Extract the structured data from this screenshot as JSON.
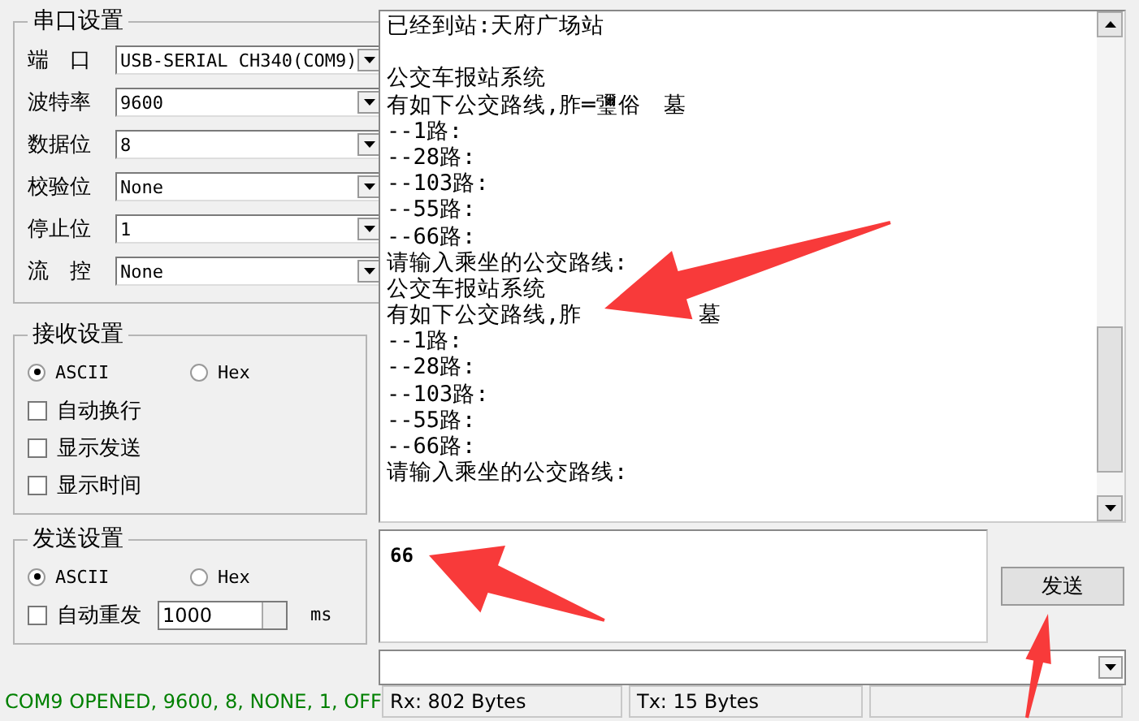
{
  "serial_settings": {
    "title": "串口设置",
    "fields": [
      {
        "label": "端　口",
        "value": "USB-SERIAL CH340(COM9)"
      },
      {
        "label": "波特率",
        "value": "9600"
      },
      {
        "label": "数据位",
        "value": "8"
      },
      {
        "label": "校验位",
        "value": "None"
      },
      {
        "label": "停止位",
        "value": "1"
      },
      {
        "label": "流　控",
        "value": "None"
      }
    ]
  },
  "receive_settings": {
    "title": "接收设置",
    "modes": [
      {
        "label": "ASCII",
        "selected": true
      },
      {
        "label": "Hex",
        "selected": false
      }
    ],
    "options": [
      {
        "label": "自动换行",
        "checked": false
      },
      {
        "label": "显示发送",
        "checked": false
      },
      {
        "label": "显示时间",
        "checked": false
      }
    ]
  },
  "send_settings": {
    "title": "发送设置",
    "modes": [
      {
        "label": "ASCII",
        "selected": true
      },
      {
        "label": "Hex",
        "selected": false
      }
    ],
    "auto_resend": {
      "label": "自动重发",
      "checked": false,
      "interval": "1000",
      "unit": "ms"
    }
  },
  "receive_area": {
    "lines": [
      {
        "kind": "text",
        "text": "已经到站:天府广场站"
      },
      {
        "kind": "blank"
      },
      {
        "kind": "text",
        "text": "公交车报站系统"
      },
      {
        "kind": "text",
        "text": "有如下公交路线,胙═瓕俗　墓"
      },
      {
        "kind": "text",
        "text": "--1路:"
      },
      {
        "kind": "text",
        "text": "--28路:"
      },
      {
        "kind": "text",
        "text": "--103路:"
      },
      {
        "kind": "text",
        "text": "--55路:"
      },
      {
        "kind": "text",
        "text": "--66路:"
      },
      {
        "kind": "text",
        "text": "请输入乘坐的公交路线:"
      },
      {
        "kind": "text",
        "text": "公交车报站系统"
      },
      {
        "kind": "text",
        "text": "有如下公交路线,胙",
        "tail": "墓"
      },
      {
        "kind": "text",
        "text": "--1路:"
      },
      {
        "kind": "text",
        "text": "--28路:"
      },
      {
        "kind": "text",
        "text": "--103路:"
      },
      {
        "kind": "text",
        "text": "--55路:"
      },
      {
        "kind": "text",
        "text": "--66路:"
      },
      {
        "kind": "text",
        "text": "请输入乘坐的公交路线:"
      }
    ]
  },
  "send_area": {
    "value": "66"
  },
  "send_button": "发送",
  "status_bar": {
    "connection": "COM9 OPENED, 9600, 8, NONE, 1, OFF",
    "rx": "Rx: 802 Bytes",
    "tx": "Tx: 15 Bytes"
  }
}
